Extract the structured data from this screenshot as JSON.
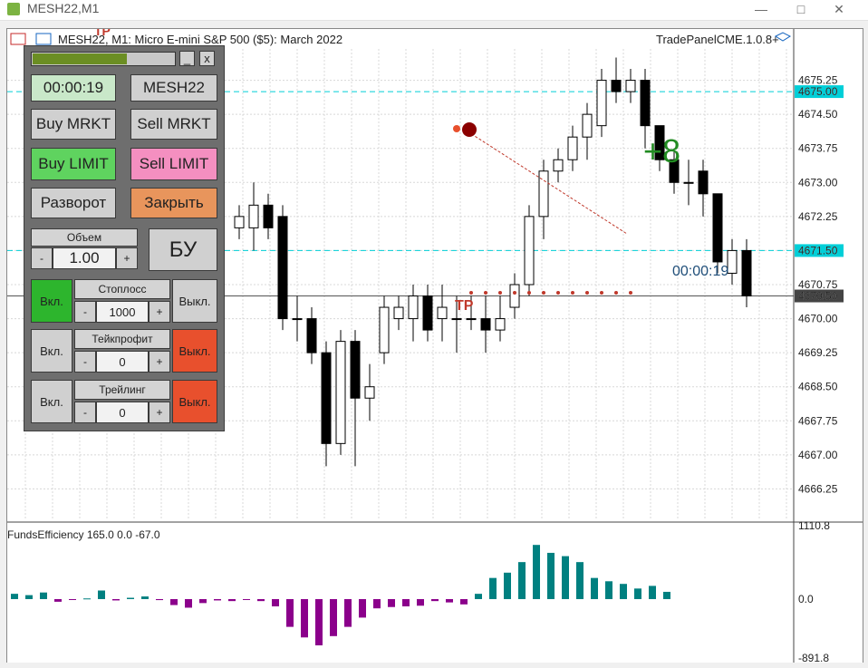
{
  "window": {
    "title": "MESH22,M1",
    "minimize_icon": "minimize-icon",
    "maximize_icon": "maximize-icon",
    "close_icon": "close-icon"
  },
  "chart": {
    "header": "MESH22, M1:  Micro E-mini S&P 500 ($5): March 2022",
    "panel_name": "TradePanelCME.1.0.8+",
    "profit": "+8",
    "timer": "00:00:19",
    "tp_label": "TP",
    "colors": {
      "bull": "#ffffff",
      "bear": "#000000",
      "grid": "#d8d8d8",
      "hline": "#00cfd8",
      "profit": "#228b22",
      "histo_pos": "#008080",
      "histo_neg": "#8b008b"
    }
  },
  "chart_data": [
    {
      "type": "candlestick",
      "title": "MESH22, M1",
      "ylim": [
        4665.6,
        4675.9
      ],
      "yticks": [
        "4675.25",
        "4675.00",
        "4674.50",
        "4673.75",
        "4673.00",
        "4672.25",
        "4671.50",
        "4670.75",
        "4670.50",
        "4670.00",
        "4669.25",
        "4668.50",
        "4667.75",
        "4667.00",
        "4666.25"
      ],
      "level_lines": [
        4675.0,
        4671.5
      ],
      "current_price": 4670.5,
      "candles": [
        {
          "o": 4672.0,
          "c": 4672.25,
          "h": 4672.5,
          "l": 4671.75
        },
        {
          "o": 4672.0,
          "c": 4672.5,
          "h": 4673.0,
          "l": 4671.5
        },
        {
          "o": 4672.5,
          "c": 4672.0,
          "h": 4672.75,
          "l": 4671.75
        },
        {
          "o": 4672.25,
          "c": 4670.0,
          "h": 4672.5,
          "l": 4669.75
        },
        {
          "o": 4670.0,
          "c": 4670.0,
          "h": 4670.5,
          "l": 4669.5
        },
        {
          "o": 4670.0,
          "c": 4669.25,
          "h": 4670.25,
          "l": 4669.0
        },
        {
          "o": 4669.25,
          "c": 4667.25,
          "h": 4669.5,
          "l": 4666.75
        },
        {
          "o": 4667.25,
          "c": 4669.5,
          "h": 4669.75,
          "l": 4667.0
        },
        {
          "o": 4669.5,
          "c": 4668.25,
          "h": 4669.75,
          "l": 4666.75
        },
        {
          "o": 4668.25,
          "c": 4668.5,
          "h": 4669.0,
          "l": 4667.75
        },
        {
          "o": 4669.25,
          "c": 4670.25,
          "h": 4670.5,
          "l": 4669.0
        },
        {
          "o": 4670.0,
          "c": 4670.25,
          "h": 4670.5,
          "l": 4669.75
        },
        {
          "o": 4670.0,
          "c": 4670.5,
          "h": 4670.75,
          "l": 4669.5
        },
        {
          "o": 4670.5,
          "c": 4669.75,
          "h": 4670.75,
          "l": 4669.5
        },
        {
          "o": 4670.0,
          "c": 4670.25,
          "h": 4670.75,
          "l": 4669.5
        },
        {
          "o": 4670.0,
          "c": 4670.0,
          "h": 4670.5,
          "l": 4669.25
        },
        {
          "o": 4670.0,
          "c": 4670.0,
          "h": 4670.5,
          "l": 4669.75
        },
        {
          "o": 4670.0,
          "c": 4669.75,
          "h": 4670.5,
          "l": 4669.25
        },
        {
          "o": 4669.75,
          "c": 4670.0,
          "h": 4670.5,
          "l": 4669.5
        },
        {
          "o": 4670.25,
          "c": 4670.75,
          "h": 4671.0,
          "l": 4670.0
        },
        {
          "o": 4670.75,
          "c": 4672.25,
          "h": 4672.5,
          "l": 4670.5
        },
        {
          "o": 4672.25,
          "c": 4673.25,
          "h": 4673.5,
          "l": 4671.75
        },
        {
          "o": 4673.25,
          "c": 4673.5,
          "h": 4673.75,
          "l": 4673.0
        },
        {
          "o": 4673.5,
          "c": 4674.0,
          "h": 4674.25,
          "l": 4673.25
        },
        {
          "o": 4674.0,
          "c": 4674.5,
          "h": 4674.75,
          "l": 4673.5
        },
        {
          "o": 4674.25,
          "c": 4675.25,
          "h": 4675.5,
          "l": 4674.0
        },
        {
          "o": 4675.25,
          "c": 4675.0,
          "h": 4675.75,
          "l": 4674.75
        },
        {
          "o": 4675.0,
          "c": 4675.25,
          "h": 4675.5,
          "l": 4674.75
        },
        {
          "o": 4675.25,
          "c": 4674.25,
          "h": 4675.5,
          "l": 4673.75
        },
        {
          "o": 4674.25,
          "c": 4673.5,
          "h": 4674.25,
          "l": 4673.25
        },
        {
          "o": 4673.5,
          "c": 4673.0,
          "h": 4673.75,
          "l": 4672.75
        },
        {
          "o": 4673.0,
          "c": 4673.0,
          "h": 4673.5,
          "l": 4672.5
        },
        {
          "o": 4673.25,
          "c": 4672.75,
          "h": 4673.5,
          "l": 4672.25
        },
        {
          "o": 4672.75,
          "c": 4671.25,
          "h": 4672.75,
          "l": 4671.0
        },
        {
          "o": 4671.0,
          "c": 4671.5,
          "h": 4671.75,
          "l": 4670.75
        },
        {
          "o": 4671.5,
          "c": 4670.5,
          "h": 4671.75,
          "l": 4670.25
        }
      ]
    },
    {
      "type": "bar",
      "title": "FundsEfficiency 165.0 0.0 -67.0",
      "ylim": [
        -891.8,
        1110.8
      ],
      "yticks": [
        "1110.8",
        "0.0",
        "-891.8"
      ],
      "values": [
        80,
        60,
        100,
        -40,
        -10,
        10,
        130,
        -20,
        20,
        40,
        -15,
        -90,
        -130,
        -60,
        -20,
        -30,
        -10,
        -30,
        -110,
        -420,
        -580,
        -700,
        -560,
        -420,
        -280,
        -140,
        -120,
        -110,
        -100,
        -30,
        -50,
        -80,
        80,
        320,
        400,
        560,
        820,
        700,
        650,
        560,
        320,
        270,
        230,
        160,
        200,
        110
      ]
    }
  ],
  "panel": {
    "timer_btn": "00:00:19",
    "symbol_btn": "MESH22",
    "buy_market": "Buy MRKT",
    "sell_market": "Sell MRKT",
    "buy_limit": "Buy LIMIT",
    "sell_limit": "Sell LIMIT",
    "reverse": "Разворот",
    "close": "Закрыть",
    "volume_label": "Объем",
    "volume_value": "1.00",
    "minus": "-",
    "plus": "+",
    "breakeven": "БУ",
    "close_x": "x",
    "min_btn": "_",
    "stoploss": {
      "on": "Вкл.",
      "label": "Стоплосс",
      "value": "1000",
      "off": "Выкл."
    },
    "takeprofit": {
      "on": "Вкл.",
      "label": "Тейкпрофит",
      "value": "0",
      "off": "Выкл."
    },
    "trailing": {
      "on": "Вкл.",
      "label": "Трейлинг",
      "value": "0",
      "off": "Выкл."
    },
    "colors": {
      "on_active": "#2db52d",
      "off_active": "#e8502d",
      "buy_limit": "#5fd35f",
      "sell_limit": "#f48fc0",
      "close": "#e8955c"
    }
  }
}
